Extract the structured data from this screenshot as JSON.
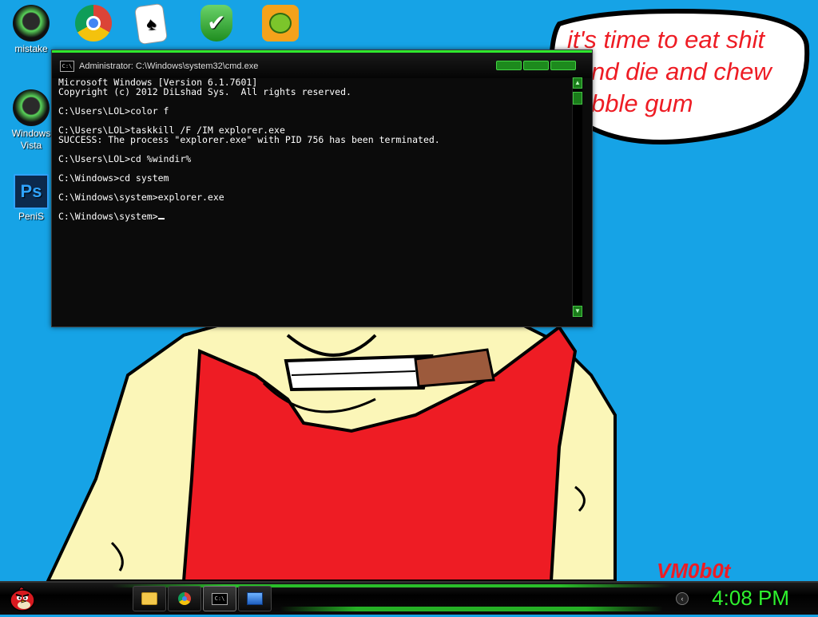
{
  "desktop": {
    "icons": [
      {
        "label": "mistake",
        "icon": "green-orb-icon"
      },
      {
        "label": "",
        "icon": "chrome-icon"
      },
      {
        "label": "",
        "icon": "solitaire-icon"
      },
      {
        "label": "",
        "icon": "security-shield-icon"
      },
      {
        "label": "",
        "icon": "bad-piggies-icon"
      },
      {
        "label": "Windows Vista",
        "icon": "green-orb-icon"
      },
      {
        "label": "PeniS",
        "icon": "photoshop-icon"
      }
    ]
  },
  "wallpaper": {
    "speech_bubble": "it's time to eat shit and die and chew bubble gum",
    "speech_bubble_visible": "it's time to eat shit\nnd die and chew\nbble gum",
    "watermark": "VM0b0t"
  },
  "cmd_window": {
    "title": "Administrator: C:\\Windows\\system32\\cmd.exe",
    "icon_text": "C:\\",
    "lines": [
      "Microsoft Windows [Version 6.1.7601]",
      "Copyright (c) 2012 DiLshad Sys.  All rights reserved.",
      "",
      "C:\\Users\\LOL>color f",
      "",
      "C:\\Users\\LOL>taskkill /F /IM explorer.exe",
      "SUCCESS: The process \"explorer.exe\" with PID 756 has been terminated.",
      "",
      "C:\\Users\\LOL>cd %windir%",
      "",
      "C:\\Windows>cd system",
      "",
      "C:\\Windows\\system>explorer.exe",
      "",
      "C:\\Windows\\system>"
    ]
  },
  "taskbar": {
    "start_icon": "angry-bird-icon",
    "buttons": [
      {
        "name": "folder-icon"
      },
      {
        "name": "chrome-icon"
      },
      {
        "name": "cmd-icon",
        "text": "C:\\"
      },
      {
        "name": "network-icon"
      }
    ],
    "clock": "4:08 PM"
  },
  "colors": {
    "desktop_bg": "#16a3e6",
    "accent_green": "#2ee82e",
    "bubble_text": "#ee1c24"
  }
}
